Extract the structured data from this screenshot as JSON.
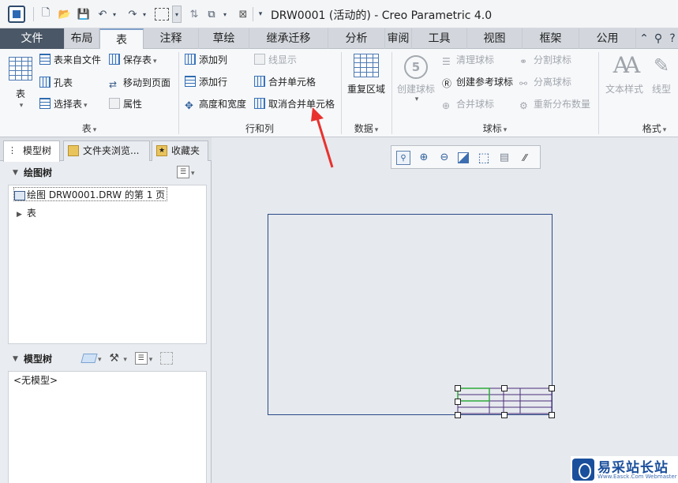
{
  "window": {
    "title": "DRW0001 (活动的) - Creo Parametric 4.0"
  },
  "tabs": [
    {
      "label": "文件"
    },
    {
      "label": "布局"
    },
    {
      "label": "表"
    },
    {
      "label": "注释"
    },
    {
      "label": "草绘"
    },
    {
      "label": "继承迁移"
    },
    {
      "label": "分析"
    },
    {
      "label": "审阅"
    },
    {
      "label": "工具"
    },
    {
      "label": "视图"
    },
    {
      "label": "框架"
    },
    {
      "label": "公用"
    }
  ],
  "ribbon": {
    "table_group": {
      "label": "表",
      "table_btn": "表",
      "from_file": "表来自文件",
      "save_table": "保存表",
      "hole_table": "孔表",
      "move_to_page": "移动到页面",
      "select_table": "选择表",
      "properties": "属性"
    },
    "rows_cols_group": {
      "label": "行和列",
      "add_column": "添加列",
      "add_row": "添加行",
      "height_width": "高度和宽度",
      "line_display": "线显示",
      "merge_cells": "合并单元格",
      "unmerge_cells": "取消合并单元格"
    },
    "data_group": {
      "label": "数据",
      "repeat_region": "重复区域"
    },
    "balloon_group": {
      "label": "球标",
      "create_balloon": "创建球标",
      "clean_balloon": "清理球标",
      "create_ref_balloon": "创建参考球标",
      "merge_balloon": "合并球标",
      "split_balloon": "分割球标",
      "detach_balloon": "分离球标",
      "redistribute": "重新分布数量"
    },
    "format_group": {
      "label": "格式",
      "text_style": "文本样式",
      "line_style": "线型"
    }
  },
  "left_panel": {
    "tabs": [
      {
        "label": "模型树"
      },
      {
        "label": "文件夹浏览..."
      },
      {
        "label": "收藏夹"
      }
    ],
    "drawing_tree": {
      "title": "绘图树",
      "items": [
        {
          "label": "绘图 DRW0001.DRW 的第 1 页"
        },
        {
          "label": "表"
        }
      ]
    },
    "model_tree": {
      "title": "模型树",
      "empty": "<无模型>"
    }
  },
  "watermark": {
    "text": "易采站长站",
    "sub": "Www.Easck.Com Webmaster"
  },
  "colors": {
    "accent": "#2f6bb0",
    "file_tab": "#4a5766",
    "arrow": "#e8322e",
    "sheet_border": "#2b4a86",
    "table_lines": "#4b2d7a",
    "selected_cell": "#2faa3a"
  }
}
